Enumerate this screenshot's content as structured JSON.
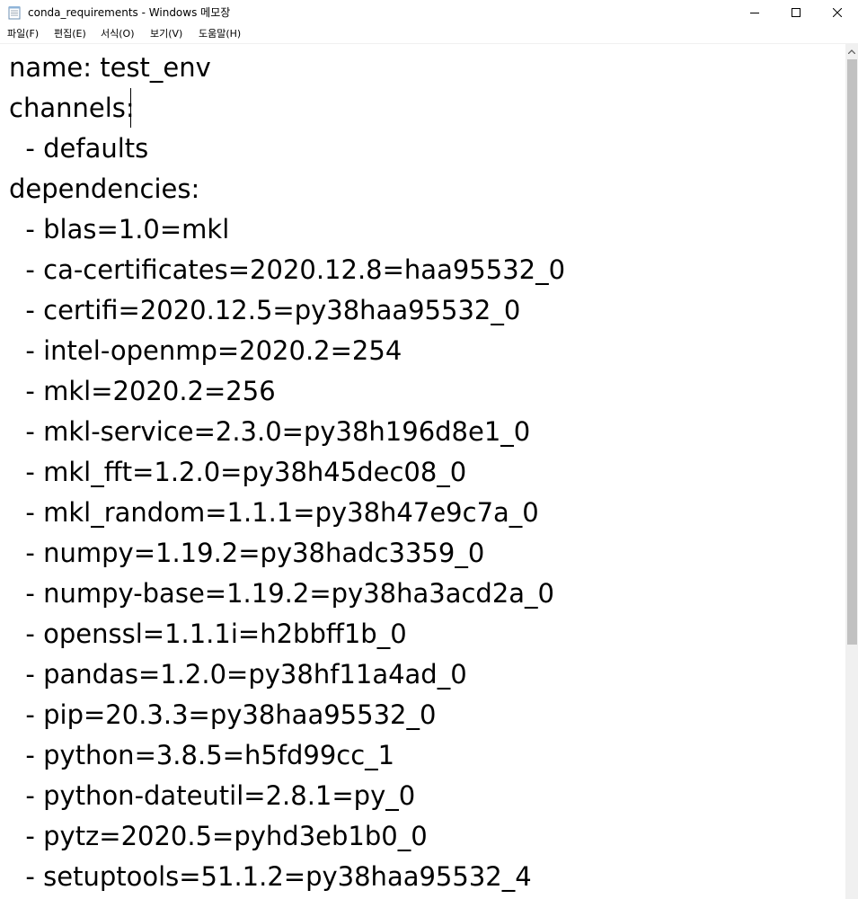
{
  "window": {
    "title": "conda_requirements - Windows 메모장",
    "icon": "notepad-icon",
    "controls": {
      "minimize": "minimize-icon",
      "maximize": "maximize-icon",
      "close": "close-icon"
    }
  },
  "menu": [
    "파일(F)",
    "편집(E)",
    "서식(O)",
    "보기(V)",
    "도움말(H)"
  ],
  "editor": {
    "lines": [
      "name: test_env",
      "channels:",
      "  - defaults",
      "dependencies:",
      "  - blas=1.0=mkl",
      "  - ca-certificates=2020.12.8=haa95532_0",
      "  - certifi=2020.12.5=py38haa95532_0",
      "  - intel-openmp=2020.2=254",
      "  - mkl=2020.2=256",
      "  - mkl-service=2.3.0=py38h196d8e1_0",
      "  - mkl_fft=1.2.0=py38h45dec08_0",
      "  - mkl_random=1.1.1=py38h47e9c7a_0",
      "  - numpy=1.19.2=py38hadc3359_0",
      "  - numpy-base=1.19.2=py38ha3acd2a_0",
      "  - openssl=1.1.1i=h2bbff1b_0",
      "  - pandas=1.2.0=py38hf11a4ad_0",
      "  - pip=20.3.3=py38haa95532_0",
      "  - python=3.8.5=h5fd99cc_1",
      "  - python-dateutil=2.8.1=py_0",
      "  - pytz=2020.5=pyhd3eb1b0_0",
      "  - setuptools=51.1.2=py38haa95532_4"
    ]
  },
  "scrollbar": {
    "up_icon": "scroll-up-arrow-icon",
    "position": 0
  }
}
